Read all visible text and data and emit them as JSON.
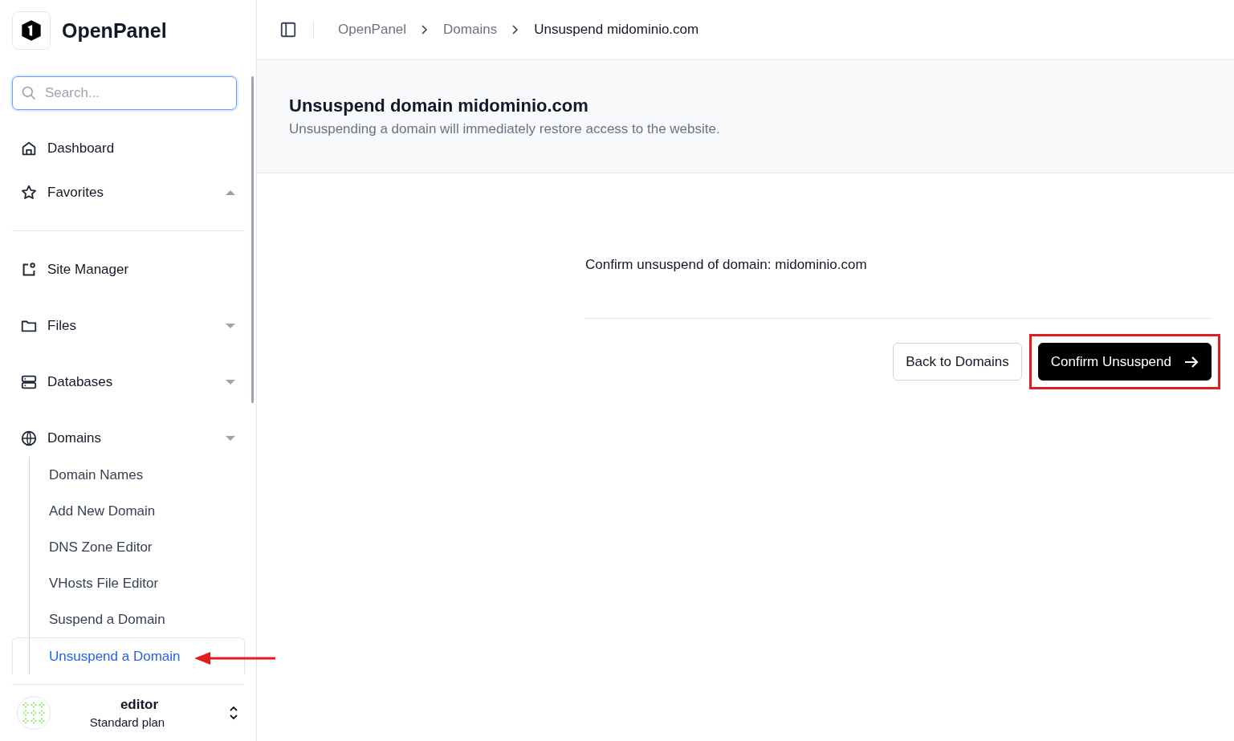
{
  "brand": {
    "name": "OpenPanel"
  },
  "search": {
    "placeholder": "Search..."
  },
  "nav": [
    {
      "kind": "link",
      "label": "Dashboard"
    },
    {
      "kind": "group",
      "label": "Favorites",
      "expanded": true
    },
    {
      "kind": "divider"
    },
    {
      "kind": "link",
      "label": "Site Manager"
    },
    {
      "kind": "group",
      "label": "Files",
      "expanded": false
    },
    {
      "kind": "group",
      "label": "Databases",
      "expanded": false
    },
    {
      "kind": "group",
      "label": "Domains",
      "expanded": false,
      "children": [
        {
          "label": "Domain Names",
          "selected": false
        },
        {
          "label": "Add New Domain",
          "selected": false
        },
        {
          "label": "DNS Zone Editor",
          "selected": false
        },
        {
          "label": "VHosts File Editor",
          "selected": false
        },
        {
          "label": "Suspend a Domain",
          "selected": false
        },
        {
          "label": "Unsuspend a Domain",
          "selected": true
        }
      ]
    }
  ],
  "user": {
    "name": "editor",
    "plan": "Standard plan"
  },
  "breadcrumbs": [
    {
      "label": "OpenPanel",
      "current": false
    },
    {
      "label": "Domains",
      "current": false
    },
    {
      "label": "Unsuspend midominio.com",
      "current": true
    }
  ],
  "page": {
    "title": "Unsuspend domain midominio.com",
    "subtitle": "Unsuspending a domain will immediately restore access to the website."
  },
  "confirm_text": "Confirm unsuspend of domain: midominio.com",
  "buttons": [
    {
      "kind": "secondary",
      "label": "Back to Domains"
    },
    {
      "kind": "primary",
      "label": "Confirm Unsuspend",
      "highlighted": true
    }
  ]
}
